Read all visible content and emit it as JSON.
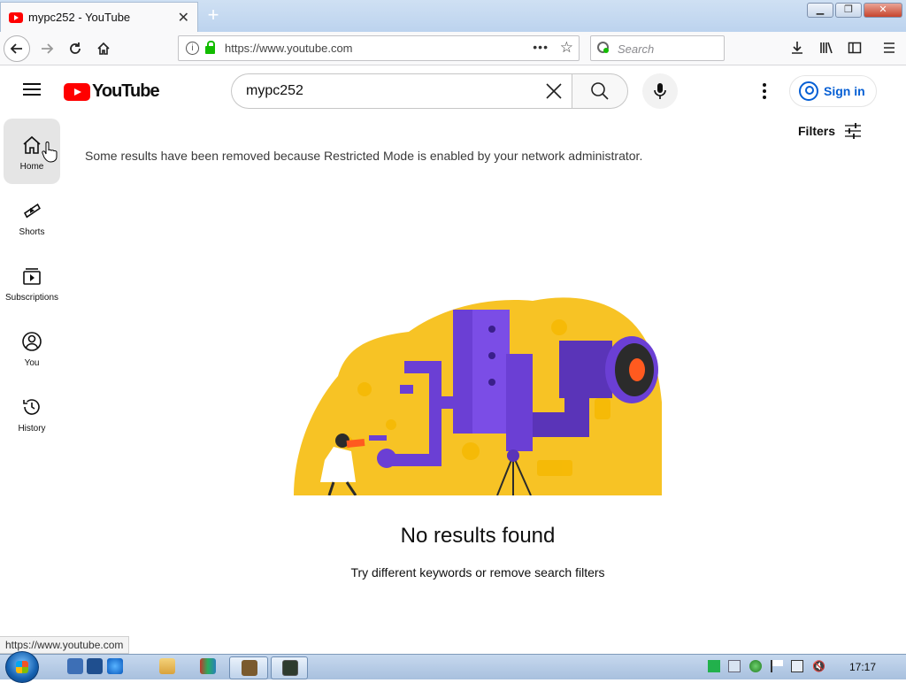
{
  "browser": {
    "tab_title": "mypc252 - YouTube",
    "url": "https://www.youtube.com",
    "search_placeholder": "Search",
    "status_url": "https://www.youtube.com"
  },
  "youtube": {
    "logo_text": "YouTube",
    "search_query": "mypc252",
    "sign_in": "Sign in",
    "filters_label": "Filters",
    "restricted_notice": "Some results have been removed because Restricted Mode is enabled by your network administrator.",
    "no_results_title": "No results found",
    "no_results_hint": "Try different keywords or remove search filters",
    "sidebar": [
      {
        "label": "Home",
        "icon": "home-icon"
      },
      {
        "label": "Shorts",
        "icon": "shorts-icon"
      },
      {
        "label": "Subscriptions",
        "icon": "subscriptions-icon"
      },
      {
        "label": "You",
        "icon": "you-icon"
      },
      {
        "label": "History",
        "icon": "history-icon"
      }
    ],
    "colors": {
      "brand_red": "#ff0000",
      "link_blue": "#065fd4",
      "illustration_yellow": "#f7c325",
      "illustration_purple": "#6b3fd4"
    }
  },
  "taskbar": {
    "clock": "17:17"
  }
}
